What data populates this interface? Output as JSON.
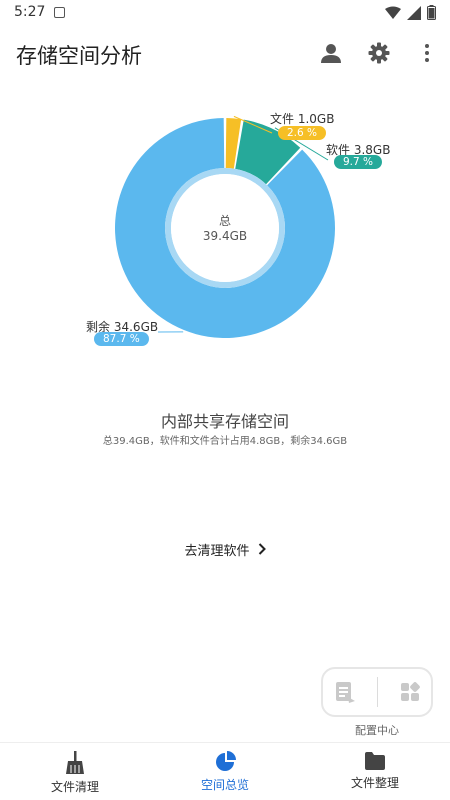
{
  "status_bar": {
    "time": "5:27"
  },
  "app_bar": {
    "title": "存储空间分析"
  },
  "chart_data": {
    "type": "pie",
    "title": "",
    "center_label": "总",
    "center_value": "39.4GB",
    "total_gb": 39.4,
    "slices": [
      {
        "name": "文件",
        "size_label": "1.0GB",
        "value": 1.0,
        "percent_label": "2.6 %",
        "percent": 2.6,
        "color": "#f6bf26"
      },
      {
        "name": "软件",
        "size_label": "3.8GB",
        "value": 3.8,
        "percent_label": "9.7 %",
        "percent": 9.7,
        "color": "#26a99a"
      },
      {
        "name": "剩余",
        "size_label": "34.6GB",
        "value": 34.6,
        "percent_label": "87.7 %",
        "percent": 87.7,
        "color": "#5bb8ee"
      }
    ]
  },
  "storage": {
    "title": "内部共享存储空间",
    "subtitle": "总39.4GB，软件和文件合计占用4.8GB，剩余34.6GB"
  },
  "actions": {
    "clean_software": "去清理软件"
  },
  "config": {
    "label": "配置中心"
  },
  "bottom_nav": {
    "items": [
      {
        "label": "文件清理",
        "icon": "broom-icon",
        "active": false
      },
      {
        "label": "空间总览",
        "icon": "pie-chart-icon",
        "active": true
      },
      {
        "label": "文件整理",
        "icon": "folder-icon",
        "active": false
      }
    ]
  },
  "colors": {
    "accent": "#1f6fd6",
    "file": "#f6bf26",
    "software": "#26a99a",
    "free": "#5bb8ee"
  }
}
